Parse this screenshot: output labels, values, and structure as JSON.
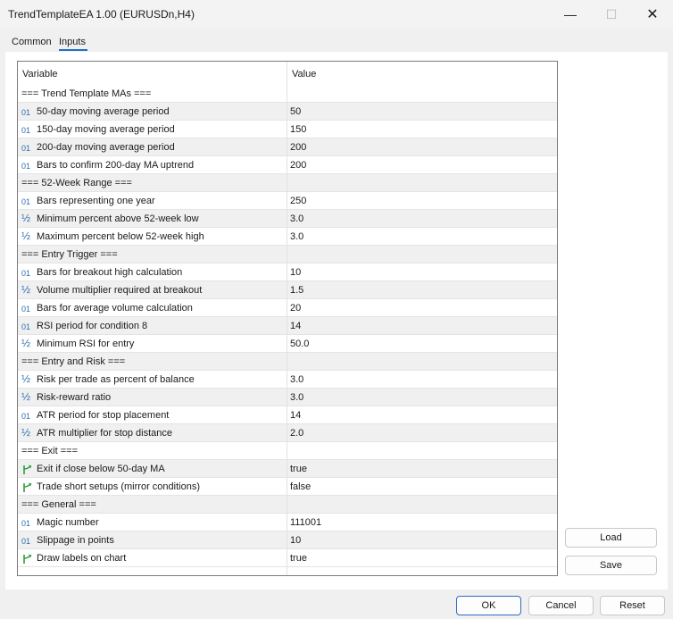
{
  "window": {
    "title": "TrendTemplateEA 1.00 (EURUSDn,H4)",
    "min_glyph": "—",
    "max_glyph": "☐",
    "close_glyph": "✕"
  },
  "tabs": [
    {
      "label": "Common"
    },
    {
      "label": "Inputs"
    }
  ],
  "grid": {
    "col_variable": "Variable",
    "col_value": "Value",
    "rows": [
      {
        "kind": "section",
        "name": "=== Trend Template MAs ===",
        "value": ""
      },
      {
        "kind": "int",
        "icon_text": "01",
        "name": "50-day moving average period",
        "value": "50"
      },
      {
        "kind": "int",
        "icon_text": "01",
        "name": "150-day moving average period",
        "value": "150"
      },
      {
        "kind": "int",
        "icon_text": "01",
        "name": "200-day moving average period",
        "value": "200"
      },
      {
        "kind": "int",
        "icon_text": "01",
        "name": "Bars to confirm 200-day MA uptrend",
        "value": "200"
      },
      {
        "kind": "section",
        "name": "=== 52-Week Range ===",
        "value": ""
      },
      {
        "kind": "int",
        "icon_text": "01",
        "name": "Bars representing one year",
        "value": "250"
      },
      {
        "kind": "double",
        "icon_text": "½",
        "name": "Minimum percent above 52-week low",
        "value": "3.0"
      },
      {
        "kind": "double",
        "icon_text": "½",
        "name": "Maximum percent below 52-week high",
        "value": "3.0"
      },
      {
        "kind": "section",
        "name": "=== Entry Trigger ===",
        "value": ""
      },
      {
        "kind": "int",
        "icon_text": "01",
        "name": "Bars for breakout high calculation",
        "value": "10"
      },
      {
        "kind": "double",
        "icon_text": "½",
        "name": "Volume multiplier required at breakout",
        "value": "1.5"
      },
      {
        "kind": "int",
        "icon_text": "01",
        "name": "Bars for average volume calculation",
        "value": "20"
      },
      {
        "kind": "int",
        "icon_text": "01",
        "name": "RSI period for condition 8",
        "value": "14"
      },
      {
        "kind": "double",
        "icon_text": "½",
        "name": "Minimum RSI for entry",
        "value": "50.0"
      },
      {
        "kind": "section",
        "name": "=== Entry and Risk ===",
        "value": ""
      },
      {
        "kind": "double",
        "icon_text": "½",
        "name": "Risk per trade as percent of balance",
        "value": "3.0"
      },
      {
        "kind": "double",
        "icon_text": "½",
        "name": "Risk-reward ratio",
        "value": "3.0"
      },
      {
        "kind": "int",
        "icon_text": "01",
        "name": "ATR period for stop placement",
        "value": "14"
      },
      {
        "kind": "double",
        "icon_text": "½",
        "name": "ATR multiplier for stop distance",
        "value": "2.0"
      },
      {
        "kind": "section",
        "name": "=== Exit ===",
        "value": ""
      },
      {
        "kind": "bool",
        "icon_text": "",
        "name": "Exit if close below 50-day MA",
        "value": "true"
      },
      {
        "kind": "bool",
        "icon_text": "",
        "name": "Trade short setups (mirror conditions)",
        "value": "false"
      },
      {
        "kind": "section",
        "name": "=== General ===",
        "value": ""
      },
      {
        "kind": "int",
        "icon_text": "01",
        "name": "Magic number",
        "value": "111001"
      },
      {
        "kind": "int",
        "icon_text": "01",
        "name": "Slippage in points",
        "value": "10"
      },
      {
        "kind": "bool",
        "icon_text": "",
        "name": "Draw labels on chart",
        "value": "true"
      }
    ]
  },
  "buttons": {
    "load": "Load",
    "save": "Save",
    "ok": "OK",
    "cancel": "Cancel",
    "reset": "Reset"
  },
  "colors": {
    "int_icon": "#2b6cb0",
    "double_icon": "#2b6cb0",
    "bool_icon": "#2e9e3a",
    "accent": "#1f6fc7"
  }
}
